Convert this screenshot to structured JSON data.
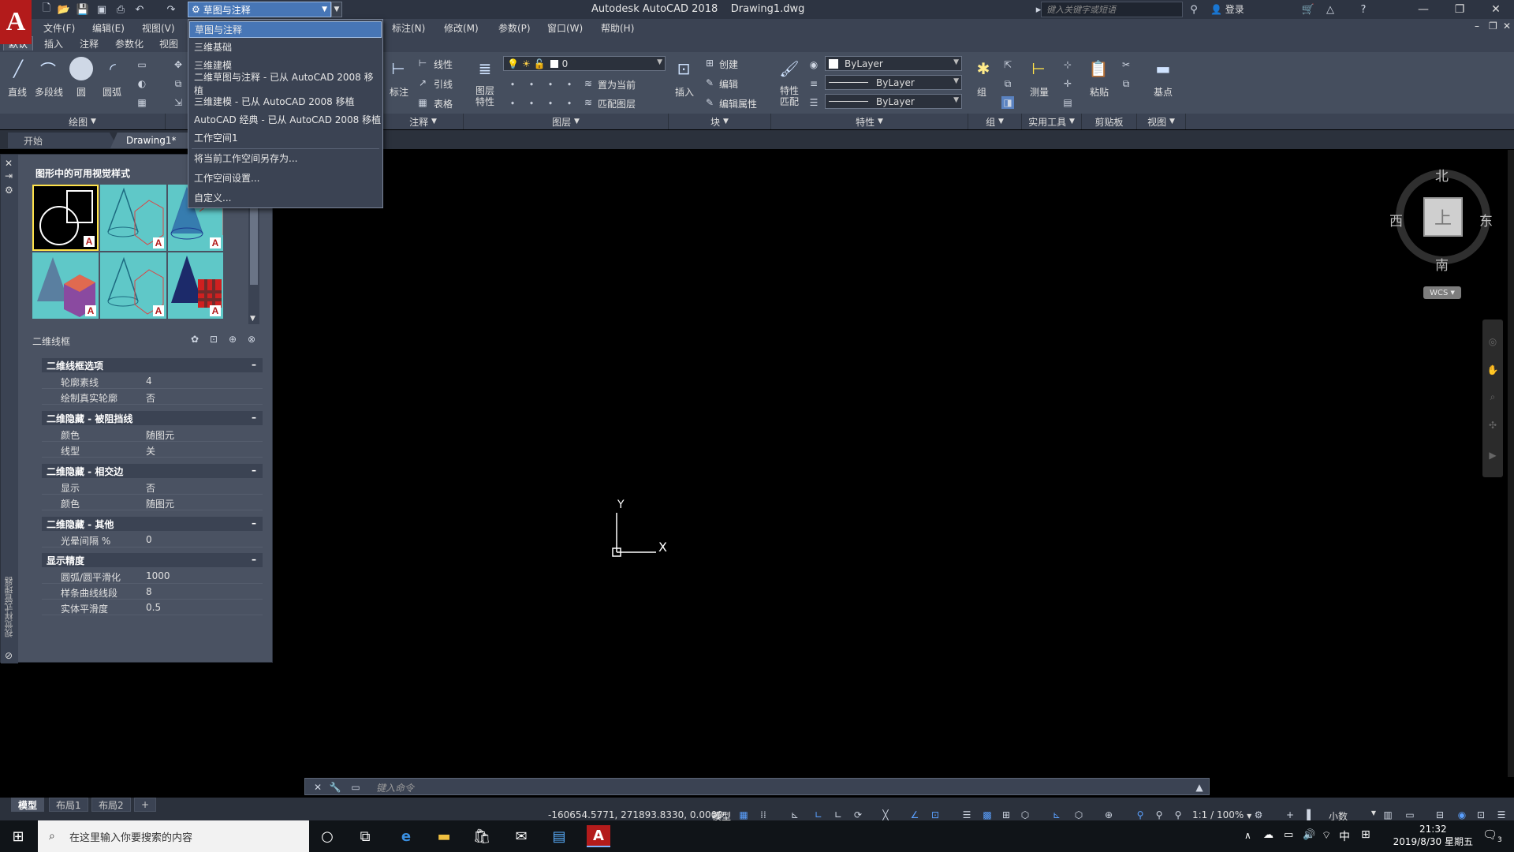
{
  "app": {
    "title": "Autodesk AutoCAD 2018",
    "document": "Drawing1.dwg",
    "logo": "A",
    "search_placeholder": "键入关键字或短语",
    "login": "登录",
    "workspace": "草图与注释"
  },
  "menubar": [
    "文件(F)",
    "编辑(E)",
    "视图(V)",
    "标注(N)",
    "修改(M)",
    "参数(P)",
    "窗口(W)",
    "帮助(H)"
  ],
  "ribbon_tabs": [
    "默认",
    "插入",
    "注释",
    "参数化",
    "视图"
  ],
  "workspace_menu": {
    "items": [
      "草图与注释",
      "三维基础",
      "三维建模",
      "二维草图与注释 - 已从 AutoCAD 2008 移植",
      "三维建模 - 已从 AutoCAD 2008 移植",
      "AutoCAD 经典 - 已从 AutoCAD 2008 移植",
      "工作空间1"
    ],
    "actions": [
      "将当前工作空间另存为...",
      "工作空间设置...",
      "自定义..."
    ]
  },
  "ribbon": {
    "draw": {
      "line": "直线",
      "polyline": "多段线",
      "circle": "圆",
      "arc": "圆弧",
      "panel": "绘图"
    },
    "annotation": {
      "dim": "标注",
      "linear": "线性",
      "leader": "引线",
      "table": "表格",
      "panel": "注释"
    },
    "layers": {
      "props": "图层\n特性",
      "current_layer": "0",
      "set_current": "置为当前",
      "match": "匹配图层",
      "panel": "图层"
    },
    "block": {
      "insert": "插入",
      "create": "创建",
      "edit": "编辑",
      "edit_attr": "编辑属性",
      "panel": "块"
    },
    "properties": {
      "match": "特性\n匹配",
      "color": "ByLayer",
      "linetype": "ByLayer",
      "lineweight": "ByLayer",
      "panel": "特性"
    },
    "groups": {
      "group": "组",
      "panel": "组"
    },
    "utilities": {
      "measure": "测量",
      "panel": "实用工具"
    },
    "clipboard": {
      "paste": "粘贴",
      "panel": "剪贴板"
    },
    "view": {
      "base": "基点",
      "panel": "视图"
    }
  },
  "file_tabs": [
    "开始",
    "Drawing1*"
  ],
  "palette": {
    "title": "图形中的可用视觉样式",
    "current_style": "二维线框",
    "vertical_title": "视觉样式管理器",
    "sections": [
      {
        "title": "二维线框选项",
        "rows": [
          {
            "k": "轮廓素线",
            "v": "4"
          },
          {
            "k": "绘制真实轮廓",
            "v": "否"
          }
        ]
      },
      {
        "title": "二维隐藏 - 被阻挡线",
        "rows": [
          {
            "k": "颜色",
            "v": "随图元"
          },
          {
            "k": "线型",
            "v": "关"
          }
        ]
      },
      {
        "title": "二维隐藏 - 相交边",
        "rows": [
          {
            "k": "显示",
            "v": "否"
          },
          {
            "k": "颜色",
            "v": "随图元"
          }
        ]
      },
      {
        "title": "二维隐藏 - 其他",
        "rows": [
          {
            "k": "光晕间隔 %",
            "v": "0"
          }
        ]
      },
      {
        "title": "显示精度",
        "rows": [
          {
            "k": "圆弧/圆平滑化",
            "v": "1000"
          },
          {
            "k": "样条曲线线段",
            "v": "8"
          },
          {
            "k": "实体平滑度",
            "v": "0.5"
          }
        ]
      }
    ]
  },
  "viewcube": {
    "north": "北",
    "south": "南",
    "east": "东",
    "west": "西",
    "face": "上",
    "wcs": "WCS"
  },
  "ucs": {
    "x": "X",
    "y": "Y"
  },
  "command": {
    "placeholder": "键入命令"
  },
  "layout_tabs": [
    "模型",
    "布局1",
    "布局2"
  ],
  "status": {
    "coords": "-160654.5771, 271893.8330, 0.0000",
    "model": "模型",
    "scale": "1:1 / 100%",
    "units": "小数"
  },
  "taskbar": {
    "search": "在这里输入你要搜索的内容",
    "time": "21:32",
    "date": "2019/8/30 星期五",
    "ime": "中",
    "notif_count": "3"
  }
}
